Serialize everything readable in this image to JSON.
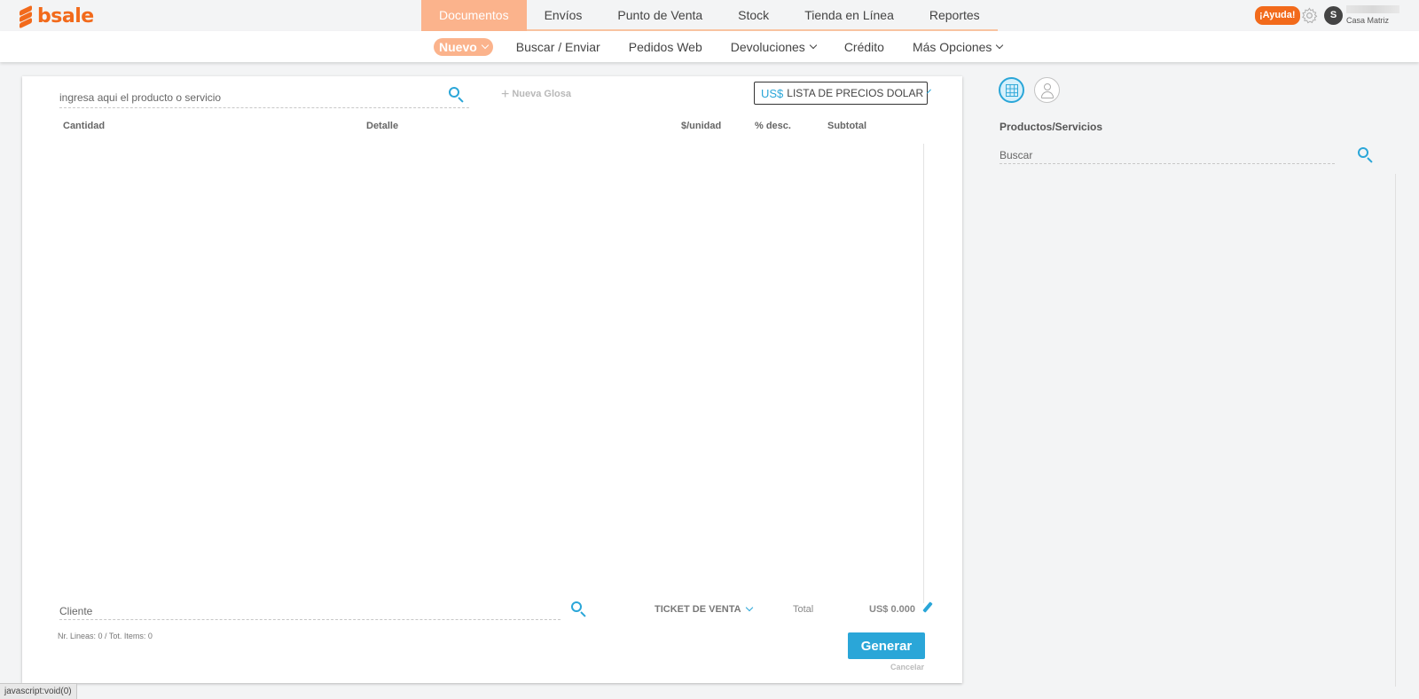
{
  "brand": {
    "name": "bsale",
    "color": "#f26a1b"
  },
  "main_nav": [
    {
      "label": "Documentos",
      "active": true
    },
    {
      "label": "Envíos",
      "active": false
    },
    {
      "label": "Punto de Venta",
      "active": false
    },
    {
      "label": "Stock",
      "active": false
    },
    {
      "label": "Tienda en Línea",
      "active": false
    },
    {
      "label": "Reportes",
      "active": false
    }
  ],
  "top_right": {
    "help_label": "¡Ayuda!",
    "avatar_initial": "S",
    "branch": "Casa Matriz"
  },
  "sub_nav": {
    "nuevo": "Nuevo",
    "buscar": "Buscar / Enviar",
    "pedidos": "Pedidos Web",
    "devoluciones": "Devoluciones",
    "credito": "Crédito",
    "mas": "Más Opciones"
  },
  "document": {
    "product_search_placeholder": "ingresa aqui el producto o servicio",
    "nueva_glosa": "Nueva Glosa",
    "price_list_currency": "US$",
    "price_list_label": "LISTA DE PRECIOS DOLAR",
    "columns": {
      "cantidad": "Cantidad",
      "detalle": "Detalle",
      "unidad": "$/unidad",
      "desc": "% desc.",
      "subtotal": "Subtotal"
    },
    "client_placeholder": "Cliente",
    "doc_type": "TICKET DE VENTA",
    "total_label": "Total",
    "total_value": "US$ 0.000",
    "lines_info": "Nr. Lineas: 0 / Tot. Items: 0",
    "generate_label": "Generar",
    "cancel_label": "Cancelar"
  },
  "right_panel": {
    "title": "Productos/Servicios",
    "search_placeholder": "Buscar"
  },
  "status_bar": "javascript:void(0)",
  "colors": {
    "accent": "#2aa6d8",
    "active_nav": "#fbb38c",
    "help": "#f26a1b"
  }
}
